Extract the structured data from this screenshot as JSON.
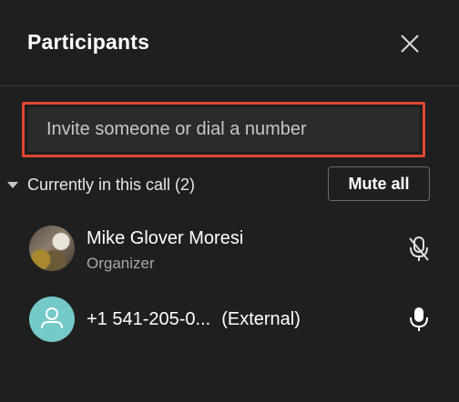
{
  "header": {
    "title": "Participants"
  },
  "invite": {
    "placeholder": "Invite someone or dial a number"
  },
  "section": {
    "label": "Currently in this call (2)",
    "mute_all_label": "Mute all"
  },
  "participants": [
    {
      "name": "Mike Glover Moresi",
      "role": "Organizer",
      "avatar": "photo",
      "mic_icon": "mic-muted-icon"
    },
    {
      "name": "+1 541-205-0...",
      "tag": "(External)",
      "avatar": "person-icon",
      "mic_icon": "mic-icon"
    }
  ],
  "colors": {
    "background": "#1f1f1f",
    "highlight_border": "#e0452f",
    "avatar_teal": "#76c9c9"
  }
}
